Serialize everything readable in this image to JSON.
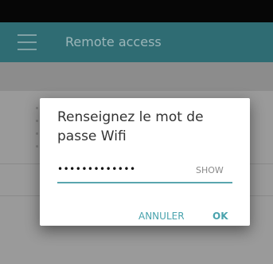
{
  "app_bar": {
    "title": "Remote access"
  },
  "dialog": {
    "title": "Renseignez le mot de passe Wifi",
    "password_value": "•••••••••••••",
    "show_label": "SHOW",
    "cancel_label": "ANNULER",
    "ok_label": "OK"
  },
  "colors": {
    "app_bar_bg": "#2f6c73",
    "accent": "#4aa3ad",
    "scrim_bg": "#9a9a9a"
  },
  "icons": {
    "menu": "hamburger-menu-icon"
  }
}
